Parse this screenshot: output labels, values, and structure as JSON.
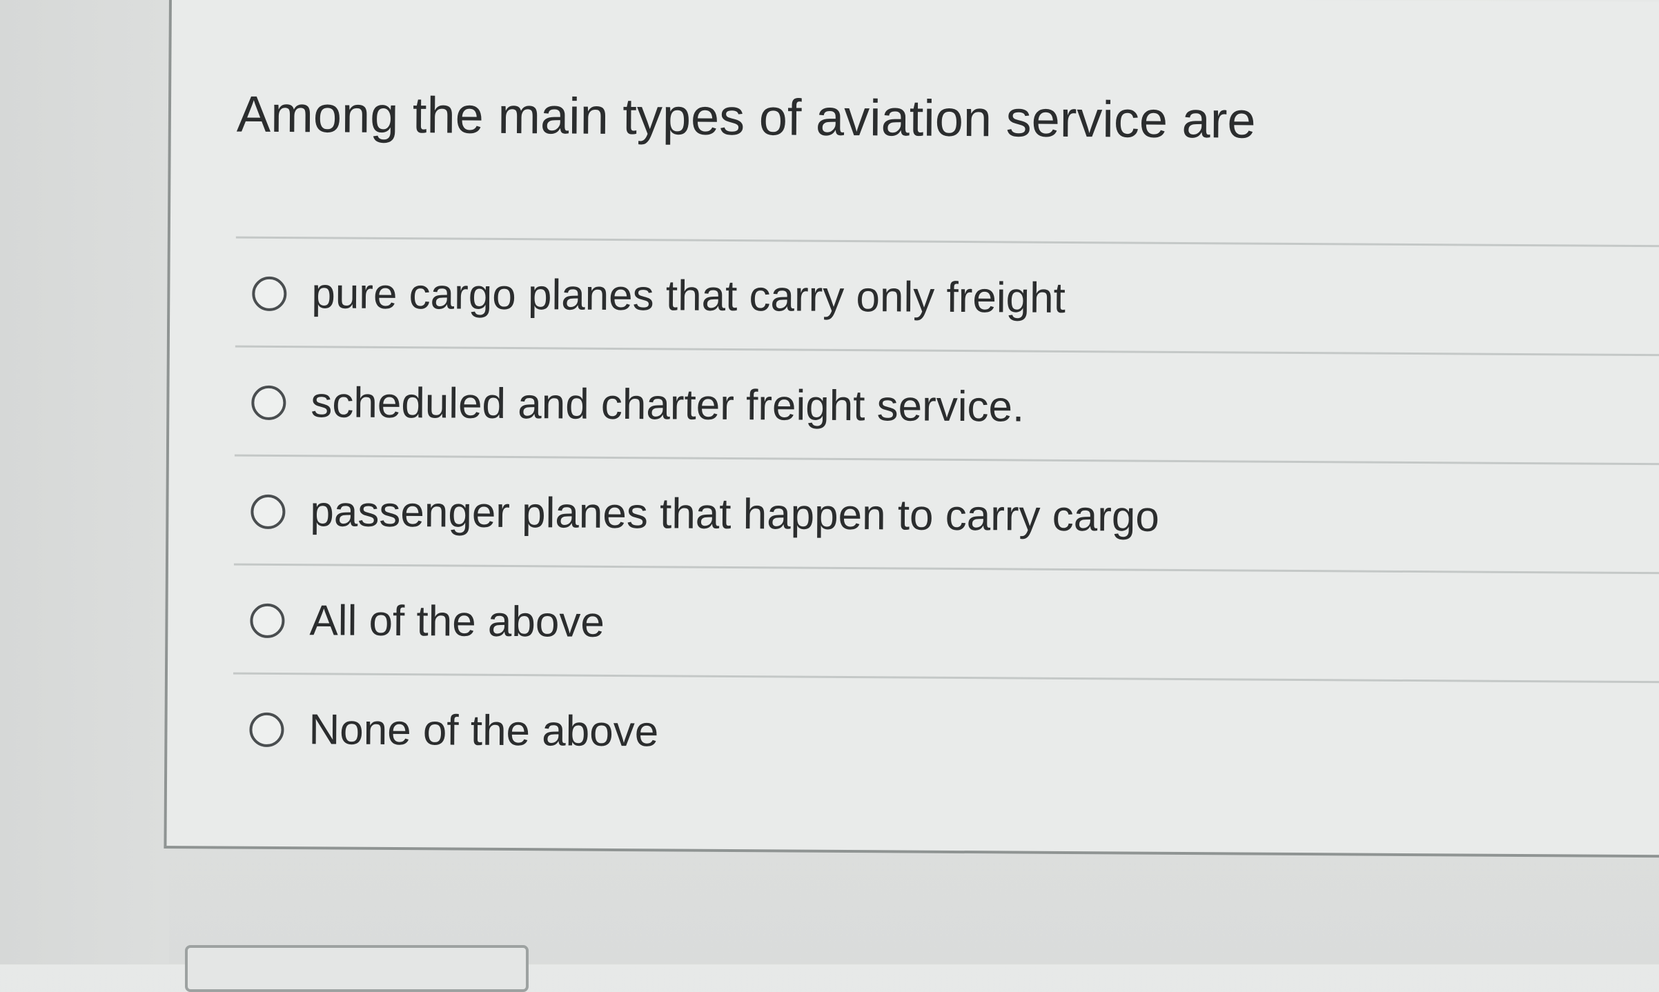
{
  "question": {
    "text": "Among the main types of aviation service are"
  },
  "answers": [
    {
      "label": "pure cargo planes that carry only freight",
      "selected": false
    },
    {
      "label": "scheduled and charter freight service.",
      "selected": false
    },
    {
      "label": "passenger planes that happen to carry cargo",
      "selected": false
    },
    {
      "label": "All of the above",
      "selected": false
    },
    {
      "label": "None of the above",
      "selected": false
    }
  ]
}
